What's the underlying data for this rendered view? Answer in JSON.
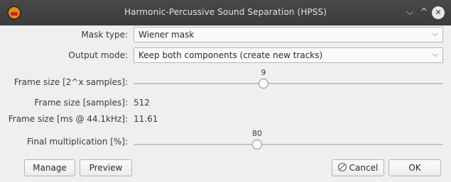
{
  "window": {
    "title": "Harmonic-Percussive Sound Separation (HPSS)",
    "controls": [
      "chevron-down-icon",
      "chevron-up-icon",
      "close-icon"
    ]
  },
  "fields": {
    "mask_type_label": "Mask type:",
    "mask_type_value": "Wiener mask",
    "output_mode_label": "Output mode:",
    "output_mode_value": "Keep both components (create new tracks)",
    "frame_size_exp_label": "Frame size [2^x samples]:",
    "frame_size_exp_value": "9",
    "frame_size_exp_fraction": 0.42,
    "frame_size_samples_label": "Frame size [samples]:",
    "frame_size_samples_value": "512",
    "frame_size_ms_label": "Frame size [ms @ 44.1kHz]:",
    "frame_size_ms_value": "11.61",
    "final_mult_label": "Final multiplication [%]:",
    "final_mult_value": "80",
    "final_mult_fraction": 0.4
  },
  "buttons": {
    "manage": "Manage",
    "preview": "Preview",
    "cancel": "Cancel",
    "ok": "OK"
  },
  "colors": {
    "titlebar": "#3c3c3c",
    "dialog_bg": "#efefef",
    "app_icon": "#e88a0f"
  }
}
